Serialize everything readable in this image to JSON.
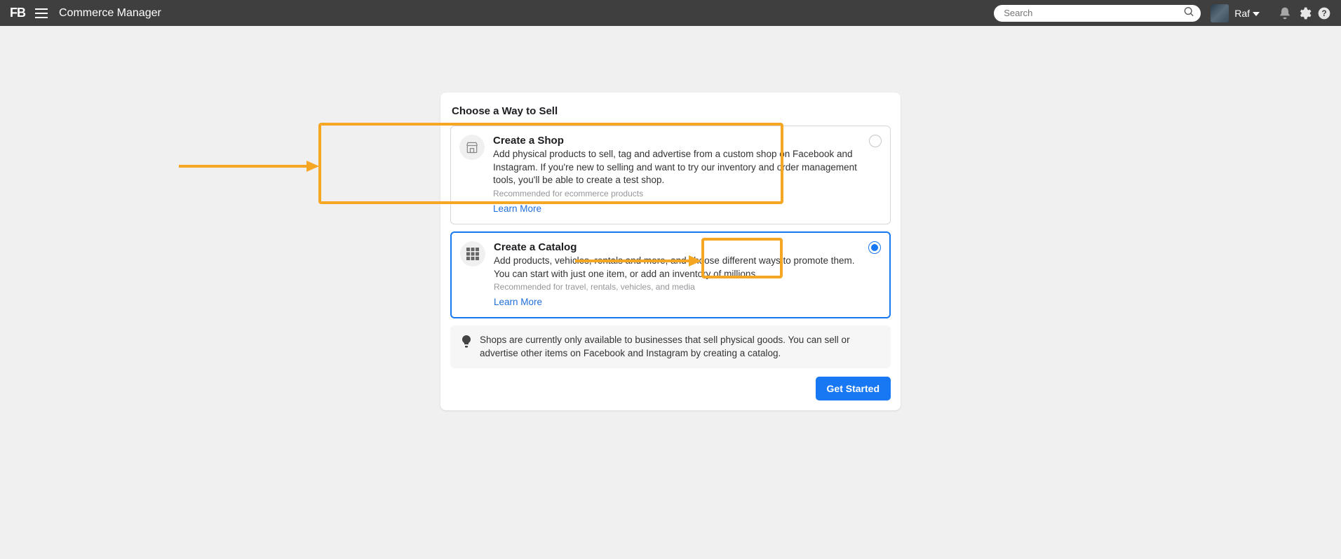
{
  "header": {
    "logo": "FB",
    "app_title": "Commerce Manager",
    "search_placeholder": "Search",
    "username": "Raf"
  },
  "card": {
    "title": "Choose a Way to Sell",
    "options": [
      {
        "title": "Create a Shop",
        "desc": "Add physical products to sell, tag and advertise from a custom shop on Facebook and Instagram. If you're new to selling and want to try our inventory and order management tools, you'll be able to create a test shop.",
        "recommended": "Recommended for ecommerce products",
        "learn_more": "Learn More",
        "selected": false,
        "icon": "shop"
      },
      {
        "title": "Create a Catalog",
        "desc": "Add products, vehicles, rentals and more, and choose different ways to promote them. You can start with just one item, or add an inventory of millions.",
        "recommended": "Recommended for travel, rentals, vehicles, and media",
        "learn_more": "Learn More",
        "selected": true,
        "icon": "grid"
      }
    ],
    "info_text": "Shops are currently only available to businesses that sell physical goods. You can sell or advertise other items on Facebook and Instagram by creating a catalog.",
    "cta_label": "Get Started"
  }
}
